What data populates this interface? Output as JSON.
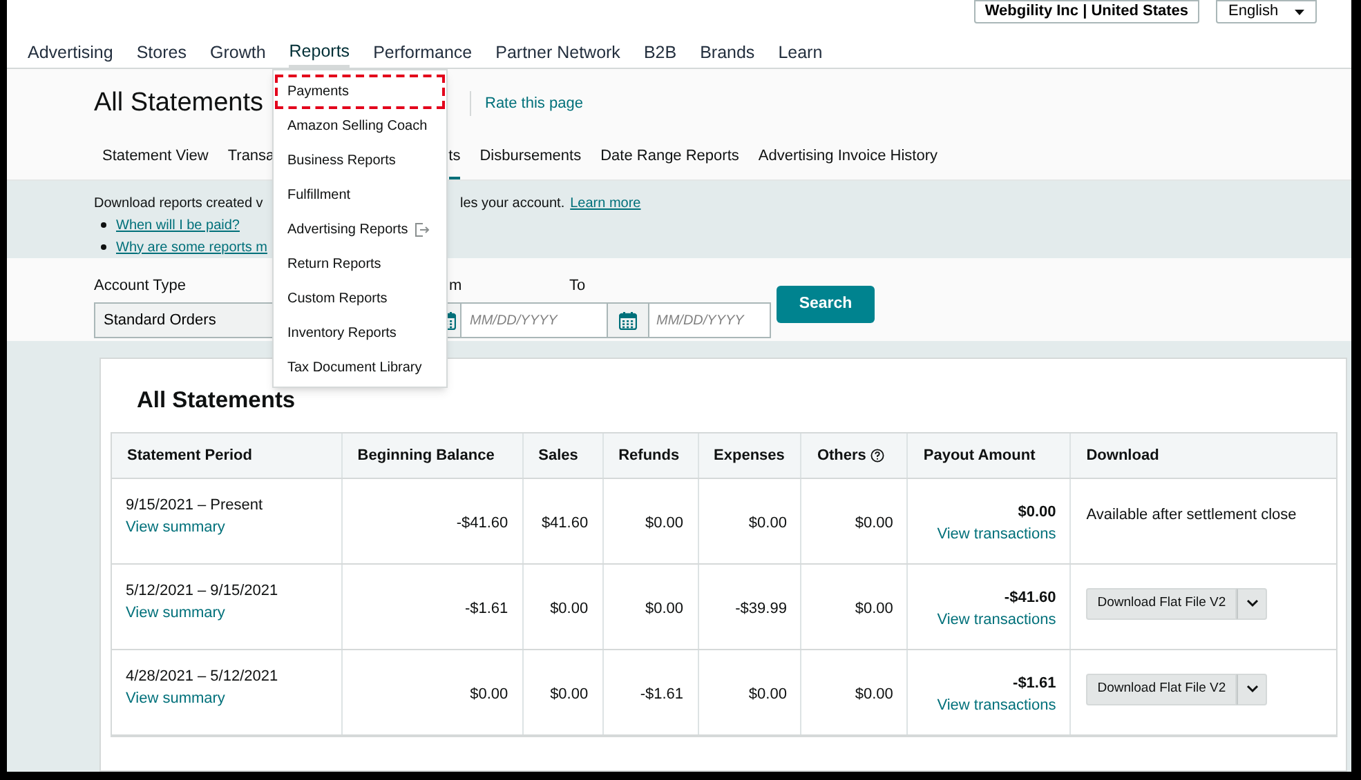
{
  "top_bar": {
    "account": "Webgility Inc | United States",
    "language": "English"
  },
  "nav": [
    {
      "label": "Advertising",
      "selected": false
    },
    {
      "label": "Stores",
      "selected": false
    },
    {
      "label": "Growth",
      "selected": false
    },
    {
      "label": "Reports",
      "selected": true
    },
    {
      "label": "Performance",
      "selected": false
    },
    {
      "label": "Partner Network",
      "selected": false
    },
    {
      "label": "B2B",
      "selected": false
    },
    {
      "label": "Brands",
      "selected": false
    },
    {
      "label": "Learn",
      "selected": false
    }
  ],
  "reports_menu": [
    {
      "label": "Payments",
      "selected": true,
      "external": false
    },
    {
      "label": "Amazon Selling Coach",
      "selected": false,
      "external": false
    },
    {
      "label": "Business Reports",
      "selected": false,
      "external": false
    },
    {
      "label": "Fulfillment",
      "selected": false,
      "external": false
    },
    {
      "label": "Advertising Reports",
      "selected": false,
      "external": true
    },
    {
      "label": "Return Reports",
      "selected": false,
      "external": false
    },
    {
      "label": "Custom Reports",
      "selected": false,
      "external": false
    },
    {
      "label": "Inventory Reports",
      "selected": false,
      "external": false
    },
    {
      "label": "Tax Document Library",
      "selected": false,
      "external": false
    }
  ],
  "page_title": "All Statements",
  "rate_link": "Rate this page",
  "tabs": [
    {
      "label": "Statement View",
      "selected": false
    },
    {
      "label": "Transa",
      "selected": false
    },
    {
      "label": "ts",
      "selected": true
    },
    {
      "label": "Disbursements",
      "selected": false
    },
    {
      "label": "Date Range Reports",
      "selected": false
    },
    {
      "label": "Advertising Invoice History",
      "selected": false
    }
  ],
  "banner": {
    "text_start": "Download reports created v",
    "text_end": "les your account.",
    "link": "Learn more",
    "bullets": [
      "When will I be paid?",
      "Why are some reports m"
    ]
  },
  "filters": {
    "account_type_label": "Account Type",
    "account_type_value": "Standard Orders",
    "from_label": "m",
    "from_placeholder": "MM/DD/YYYY",
    "to_label": "To",
    "to_placeholder": "MM/DD/YYYY",
    "search": "Search"
  },
  "statements": {
    "title": "All Statements",
    "columns": [
      "Statement Period",
      "Beginning Balance",
      "Sales",
      "Refunds",
      "Expenses",
      "Others",
      "Payout Amount",
      "Download"
    ],
    "rows": [
      {
        "period": "9/15/2021 – Present",
        "summary": "View summary",
        "beginning": "-$41.60",
        "sales": "$41.60",
        "refunds": "$0.00",
        "expenses": "$0.00",
        "others": "$0.00",
        "payout": "$0.00",
        "transactions": "View transactions",
        "kind": "text",
        "download": "Available after settlement close"
      },
      {
        "period": "5/12/2021 – 9/15/2021",
        "summary": "View summary",
        "beginning": "-$1.61",
        "sales": "$0.00",
        "refunds": "$0.00",
        "expenses": "-$39.99",
        "others": "$0.00",
        "payout": "-$41.60",
        "transactions": "View transactions",
        "kind": "button",
        "download": "Download Flat File V2"
      },
      {
        "period": "4/28/2021 – 5/12/2021",
        "summary": "View summary",
        "beginning": "$0.00",
        "sales": "$0.00",
        "refunds": "-$1.61",
        "expenses": "$0.00",
        "others": "$0.00",
        "payout": "-$1.61",
        "transactions": "View transactions",
        "kind": "button",
        "download": "Download Flat File V2"
      }
    ]
  }
}
